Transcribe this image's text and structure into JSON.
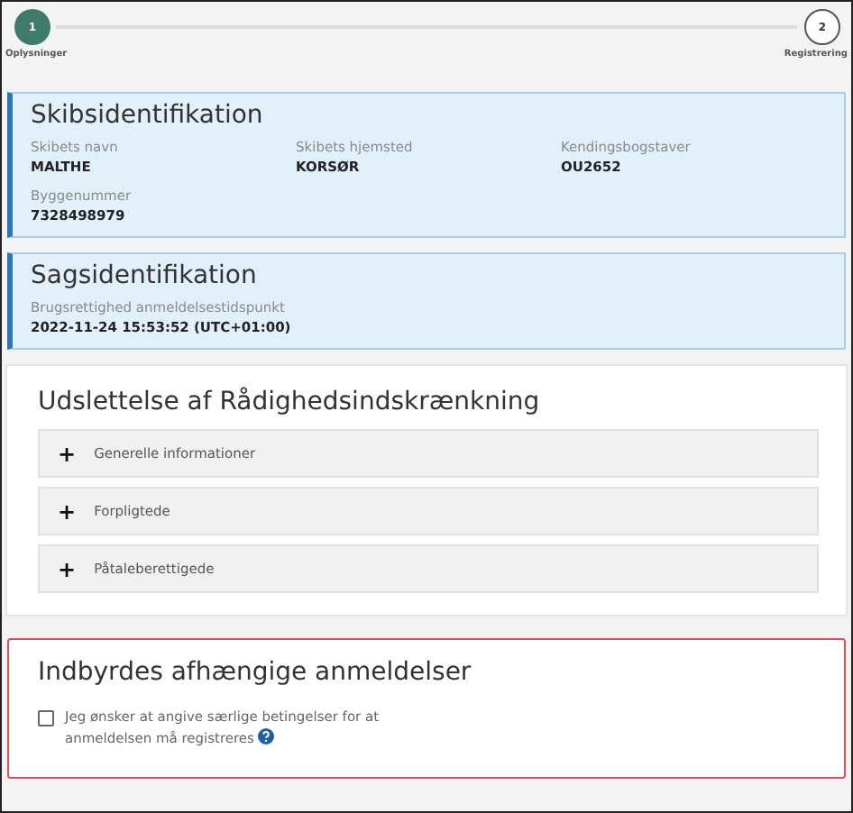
{
  "stepper": {
    "steps": [
      {
        "number": "1",
        "label": "Oplysninger",
        "selected": true
      },
      {
        "number": "2",
        "label": "Registrering",
        "selected": false
      }
    ]
  },
  "cards": [
    {
      "title": "Skibsidentifikation",
      "fields": [
        {
          "label": "Skibets navn",
          "value": "MALTHE"
        },
        {
          "label": "Skibets hjemsted",
          "value": "KORSØR"
        },
        {
          "label": "Kendingsbogstaver",
          "value": "OU2652"
        },
        {
          "label": "Byggenummer",
          "value": "7328498979"
        }
      ]
    },
    {
      "title": "Sagsidentifikation",
      "fields": [
        {
          "label": "Brugsrettighed anmeldelsestidspunkt",
          "value": "2022-11-24 15:53:52 (UTC+01:00)"
        }
      ]
    }
  ],
  "section": {
    "title": "Udslettelse af Rådighedsindskrænkning",
    "panels": [
      {
        "icon": "+",
        "label": "Generelle informationer"
      },
      {
        "icon": "+",
        "label": "Forpligtede"
      },
      {
        "icon": "+",
        "label": "Påtaleberettigede"
      }
    ]
  },
  "dependent": {
    "title": "Indbyrdes afhængige anmeldelser",
    "checkbox": {
      "label": "Jeg ønsker at angive særlige betingelser for at anmeldelsen må registreres",
      "checked": false
    }
  }
}
